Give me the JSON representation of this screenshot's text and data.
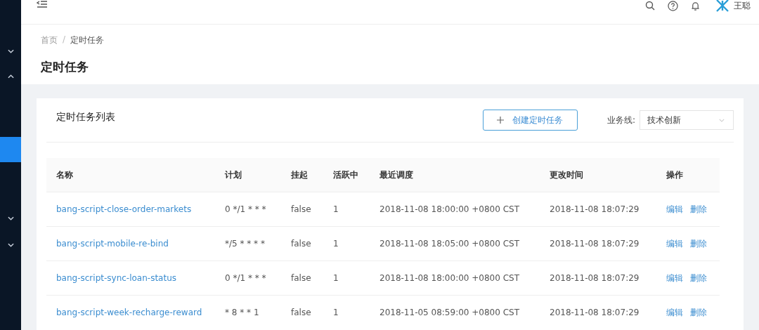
{
  "sidebar": {
    "items": [
      {
        "kind": "group",
        "expanded": false
      },
      {
        "kind": "group",
        "expanded": true
      },
      {
        "kind": "item",
        "selected": true
      },
      {
        "kind": "group",
        "expanded": false
      },
      {
        "kind": "group",
        "expanded": false
      }
    ]
  },
  "header": {
    "user_name": "王聪"
  },
  "breadcrumb": [
    "首页",
    "定时任务"
  ],
  "breadcrumb_separator": "/",
  "page_title": "定时任务",
  "card": {
    "title": "定时任务列表",
    "create_button": "创建定时任务",
    "filter_label": "业务线:",
    "filter_value": "技术创新"
  },
  "table": {
    "columns": [
      "名称",
      "计划",
      "挂起",
      "活跃中",
      "最近调度",
      "更改时间",
      "操作"
    ],
    "rows": [
      {
        "name": "bang-script-close-order-markets",
        "schedule": "0 */1 * * *",
        "suspended": "false",
        "active": "1",
        "last_run": "2018-11-08 18:00:00 +0800 CST",
        "updated": "2018-11-08 18:07:29",
        "actions": [
          "编辑",
          "删除"
        ]
      },
      {
        "name": "bang-script-mobile-re-bind",
        "schedule": "*/5 * * * *",
        "suspended": "false",
        "active": "1",
        "last_run": "2018-11-08 18:05:00 +0800 CST",
        "updated": "2018-11-08 18:07:29",
        "actions": [
          "编辑",
          "删除"
        ]
      },
      {
        "name": "bang-script-sync-loan-status",
        "schedule": "0 */1 * * *",
        "suspended": "false",
        "active": "1",
        "last_run": "2018-11-08 18:00:00 +0800 CST",
        "updated": "2018-11-08 18:07:29",
        "actions": [
          "编辑",
          "删除"
        ]
      },
      {
        "name": "bang-script-week-recharge-reward",
        "schedule": "* 8 * * 1",
        "suspended": "false",
        "active": "1",
        "last_run": "2018-11-05 08:59:00 +0800 CST",
        "updated": "2018-11-08 18:07:29",
        "actions": [
          "编辑",
          "删除"
        ]
      }
    ]
  }
}
